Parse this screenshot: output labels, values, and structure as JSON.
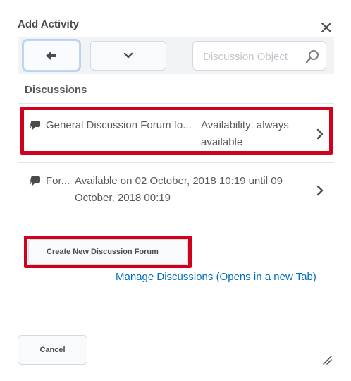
{
  "dialog": {
    "title": "Add Activity",
    "close_icon": "close-icon"
  },
  "toolbar": {
    "back_icon": "arrow-left-icon",
    "dropdown_icon": "chevron-down-icon",
    "search": {
      "placeholder": "Discussion Object",
      "value": "",
      "icon": "search-icon"
    }
  },
  "section": {
    "heading": "Discussions"
  },
  "topics": [
    {
      "name": "General Discussion Forum fo...",
      "availability": "Availability: always available",
      "icon": "chat-bubble-icon",
      "chevron": "chevron-right-icon"
    },
    {
      "name": "For...",
      "availability": "Available on 02 October, 2018 10:19 until 09 October, 2018 00:19",
      "icon": "chat-bubble-icon",
      "chevron": "chevron-right-icon"
    }
  ],
  "actions": {
    "create_label": "Create New Discussion Forum",
    "manage_label": "Manage Discussions (Opens in a new Tab)"
  },
  "footer": {
    "cancel_label": "Cancel",
    "resize_icon": "resize-grip-icon"
  },
  "colors": {
    "highlight": "#d0021b",
    "link": "#006fbf",
    "text": "#494c4e",
    "toolbar_bg": "#f2f3f5"
  }
}
